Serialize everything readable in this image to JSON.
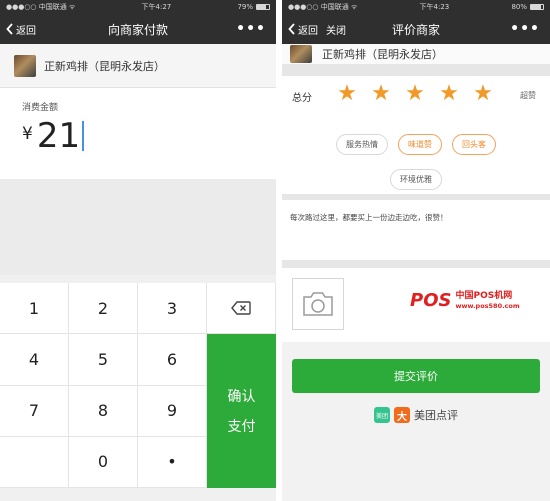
{
  "left": {
    "status": {
      "carrier": "●●●○○ 中国联通 ᯤ",
      "time": "下午4:27",
      "battery": "79%",
      "battery_level": 0.79
    },
    "nav": {
      "back_label": "返回",
      "title": "向商家付款",
      "more": "•••"
    },
    "merchant_name": "正新鸡排（昆明永发店）",
    "amount_label": "消费金额",
    "currency": "¥",
    "amount": "21",
    "keys": [
      "1",
      "2",
      "3",
      "4",
      "5",
      "6",
      "7",
      "8",
      "9",
      "0",
      "•"
    ],
    "confirm_line1": "确认",
    "confirm_line2": "支付",
    "colors": {
      "accent": "#2dab3a",
      "navbar": "#2f2f2f"
    }
  },
  "right": {
    "status": {
      "carrier": "●●●○○ 中国联通 ᯤ",
      "time": "下午4:23",
      "battery": "80%",
      "battery_level": 0.8
    },
    "nav": {
      "back_label": "返回",
      "close_label": "关闭",
      "title": "评价商家",
      "more": "•••"
    },
    "merchant_name": "正新鸡排（昆明永发店）",
    "score_label": "总分",
    "rating": {
      "value": 5,
      "max": 5
    },
    "score_word": "超赞",
    "tags_row1": [
      "服务热情",
      "味道赞",
      "回头客"
    ],
    "tags_row2": [
      "环境优雅"
    ],
    "comment": "每次路过这里，都要买上一份边走边吃，很赞！",
    "submit_label": "提交评价",
    "brand": {
      "b1": "美团",
      "b2": "大",
      "name": "美团点评"
    },
    "watermark": {
      "logo_main": "POS",
      "site_name": "中国POS机网",
      "url": "www.pos580.com"
    },
    "colors": {
      "star": "#f19a2a",
      "tag_selected": "#f08a2a",
      "submit": "#2dab3a"
    }
  }
}
